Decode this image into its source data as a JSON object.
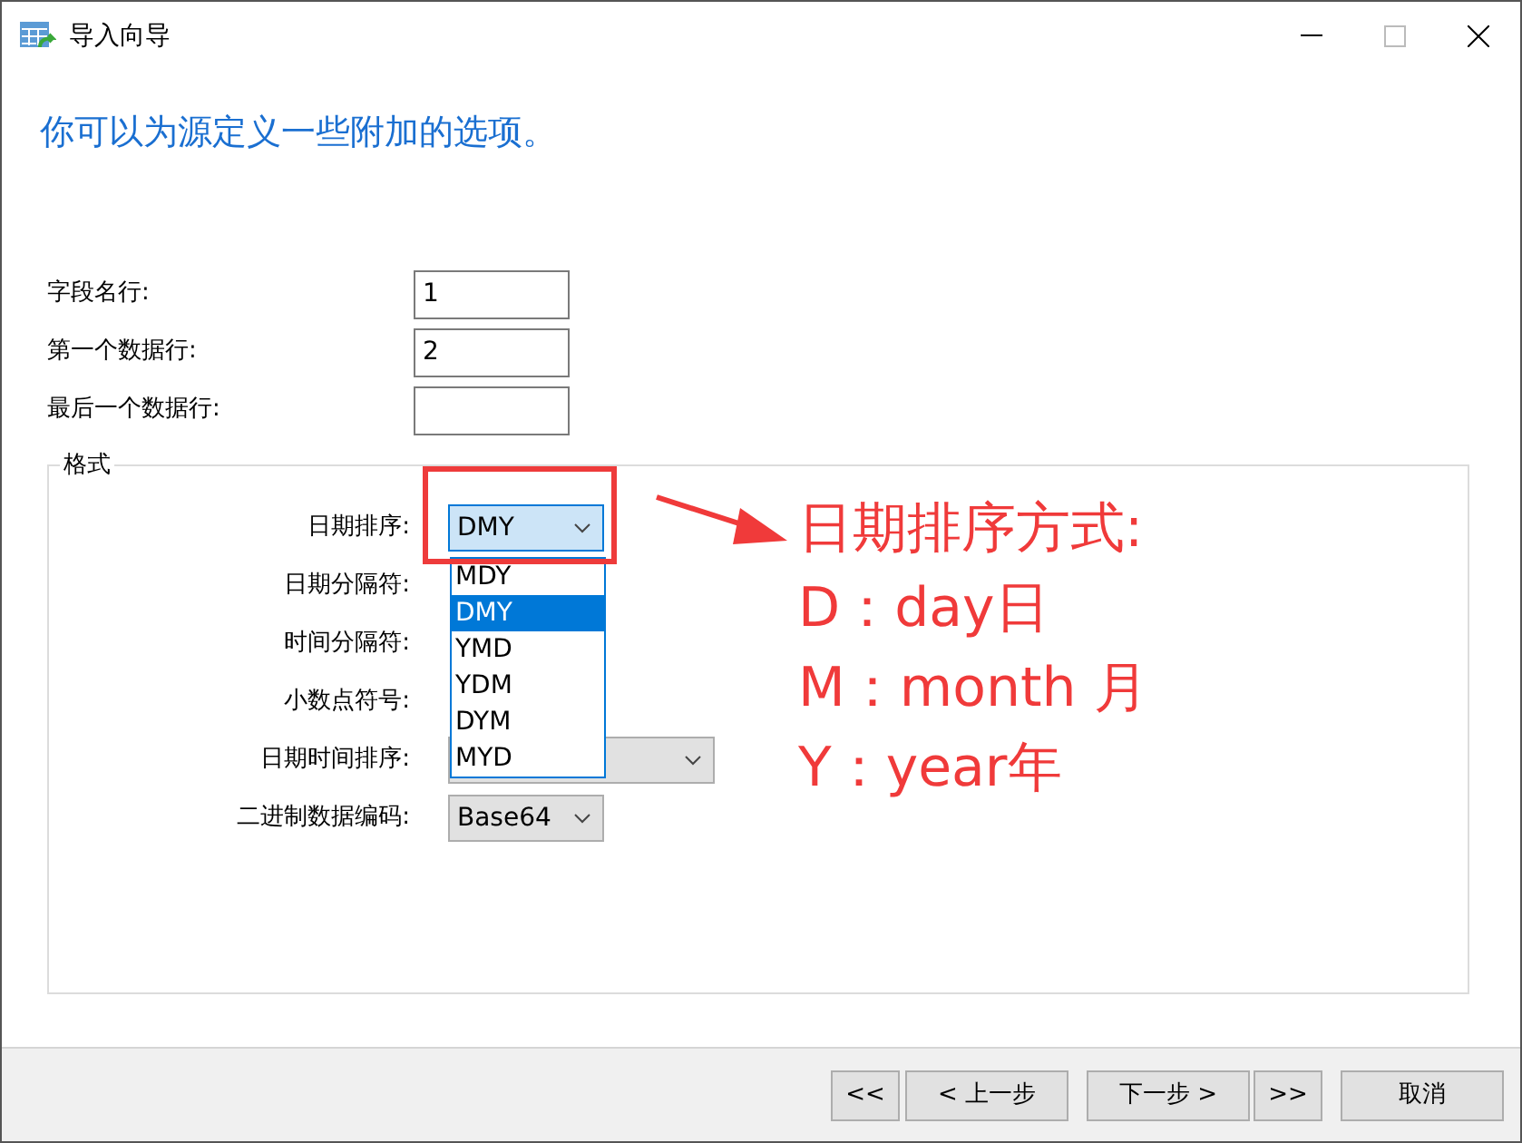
{
  "window": {
    "title": "导入向导"
  },
  "heading": "你可以为源定义一些附加的选项。",
  "fields": [
    {
      "label": "字段名行:",
      "value": "1"
    },
    {
      "label": "第一个数据行:",
      "value": "2"
    },
    {
      "label": "最后一个数据行:"
    }
  ],
  "format_group": {
    "title": "格式",
    "rows": [
      {
        "label": "日期排序:",
        "kind": "combo",
        "value": "DMY",
        "focused": true
      },
      {
        "label": "日期分隔符:",
        "kind": "covered"
      },
      {
        "label": "时间分隔符:",
        "kind": "covered"
      },
      {
        "label": "小数点符号:",
        "kind": "covered"
      },
      {
        "label": "日期时间排序:",
        "kind": "combo-wide"
      },
      {
        "label": "二进制数据编码:",
        "kind": "combo",
        "value": "Base64",
        "focused": false
      }
    ]
  },
  "dropdown": {
    "items": [
      {
        "label": "MDY",
        "selected": false
      },
      {
        "label": "DMY",
        "selected": true
      },
      {
        "label": "YMD",
        "selected": false
      },
      {
        "label": "YDM",
        "selected": false
      },
      {
        "label": "DYM",
        "selected": false
      },
      {
        "label": "MYD",
        "selected": false
      }
    ]
  },
  "buttons": [
    "<<",
    "< 上一步",
    "下一步 >",
    ">>",
    "取消"
  ],
  "annotation": {
    "lines": [
      "日期排序方式:",
      "D：day日",
      "M：month 月",
      "Y：year年"
    ]
  }
}
